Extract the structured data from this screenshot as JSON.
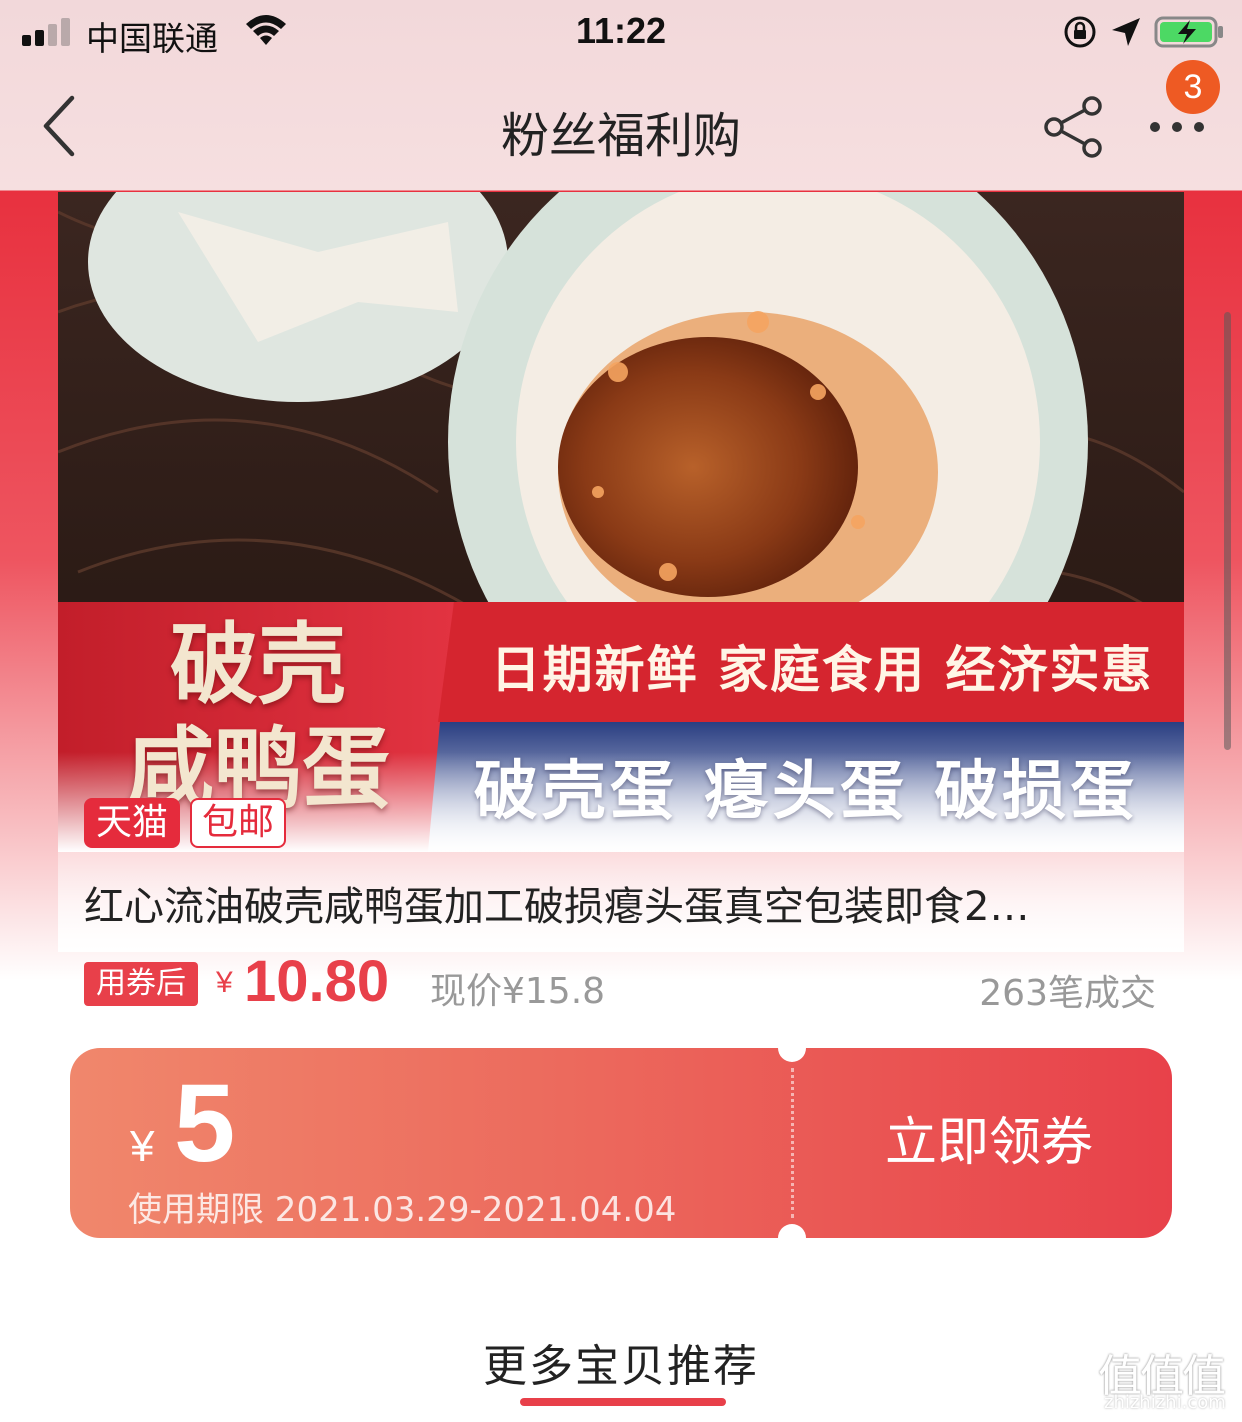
{
  "status_bar": {
    "carrier": "中国联通",
    "time": "11:22"
  },
  "nav": {
    "title": "粉丝福利购",
    "badge_count": "3"
  },
  "product": {
    "image_banner": {
      "title_line1": "破壳",
      "title_line2": "咸鸭蛋",
      "slogan1": "日期新鲜  家庭食用 经济实惠",
      "slogan2": "破壳蛋  瘪头蛋  破损蛋"
    },
    "tags": [
      "天猫",
      "包邮"
    ],
    "title": "红心流油破壳咸鸭蛋加工破损瘪头蛋真空包装即食2…",
    "coupon_tag": "用券后",
    "price_symbol": "¥",
    "price": "10.80",
    "original_price": "现价¥15.8",
    "sales": "263笔成交"
  },
  "coupon": {
    "symbol": "¥",
    "amount": "5",
    "validity": "使用期限 2021.03.29-2021.04.04",
    "claim_label": "立即领券"
  },
  "more": {
    "title": "更多宝贝推荐"
  },
  "watermark": {
    "logo": "值值值",
    "url": "zhizhizhi.com"
  },
  "colors": {
    "accent": "#e8404a",
    "badge": "#ee5a23",
    "coupon_start": "#f0876c",
    "coupon_end": "#e8414a"
  }
}
